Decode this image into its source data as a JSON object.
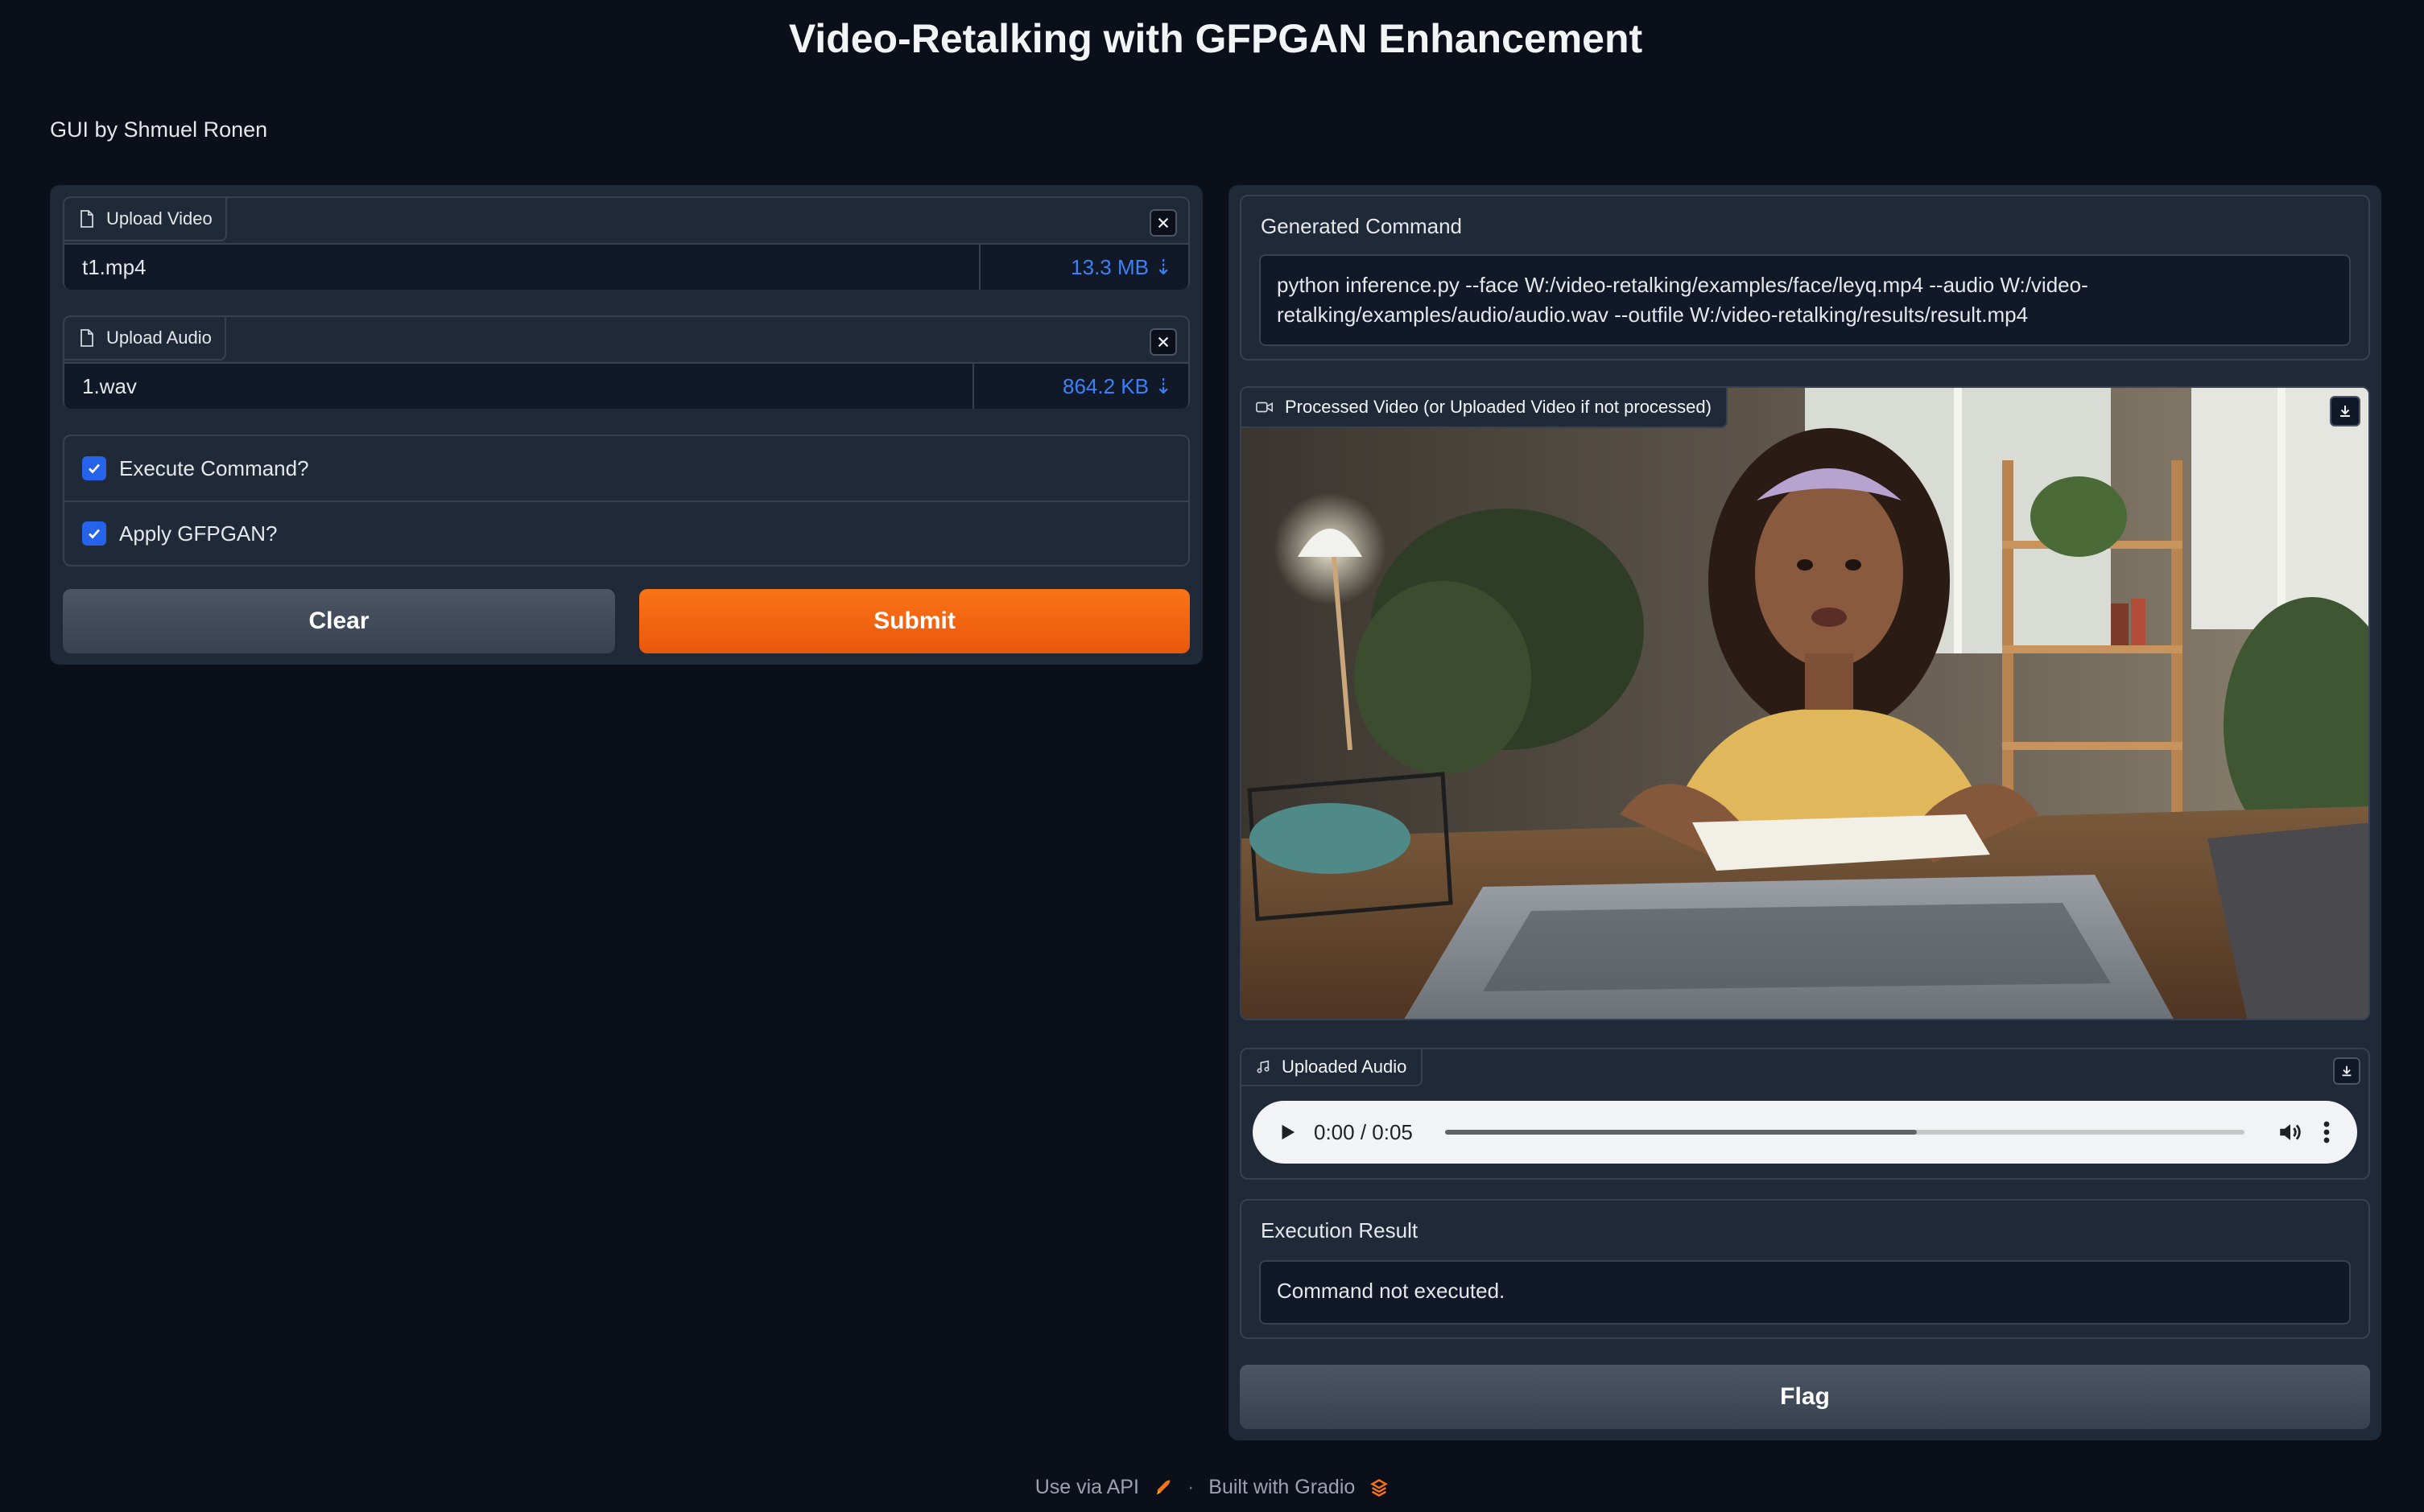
{
  "header": {
    "title": "Video-Retalking with GFPGAN Enhancement",
    "subtitle": "GUI by Shmuel Ronen"
  },
  "inputs": {
    "video": {
      "label": "Upload Video",
      "file_name": "t1.mp4",
      "file_size": "13.3 MB ⇣"
    },
    "audio": {
      "label": "Upload Audio",
      "file_name": "1.wav",
      "file_size": "864.2 KB ⇣"
    },
    "checkboxes": [
      {
        "label": "Execute Command?",
        "checked": true
      },
      {
        "label": "Apply GFPGAN?",
        "checked": true
      }
    ],
    "clear_label": "Clear",
    "submit_label": "Submit"
  },
  "outputs": {
    "command": {
      "label": "Generated Command",
      "value": "python inference.py --face W:/video-retalking/examples/face/leyq.mp4 --audio W:/video-retalking/examples/audio/audio.wav --outfile W:/video-retalking/results/result.mp4"
    },
    "video": {
      "label": "Processed Video (or Uploaded Video if not processed)"
    },
    "audio": {
      "label": "Uploaded Audio",
      "time": "0:00 / 0:05",
      "progress": 0.59
    },
    "result": {
      "label": "Execution Result",
      "value": "Command not executed."
    },
    "flag_label": "Flag"
  },
  "footer": {
    "api_label": "Use via API",
    "separator": "·",
    "built_label": "Built with Gradio"
  },
  "colors": {
    "background": "#0b0f19",
    "panel": "#1f2937",
    "accent": "#f97316",
    "link": "#3b82f6",
    "checkbox": "#2563eb"
  }
}
